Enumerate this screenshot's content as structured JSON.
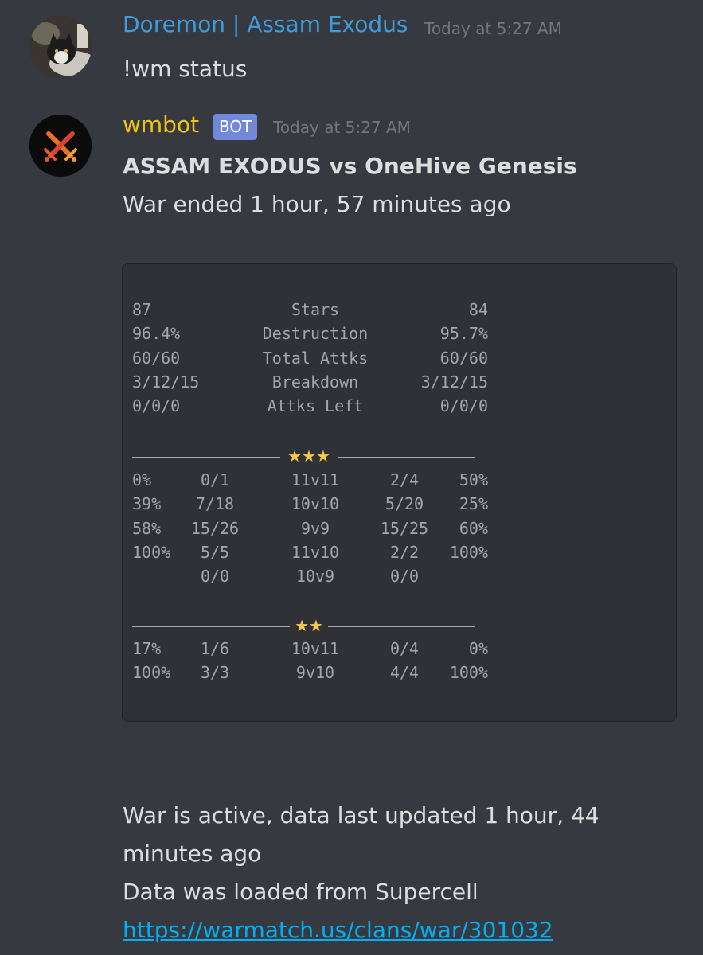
{
  "message1": {
    "username": "Doremon | Assam Exodus",
    "timestamp": "Today at 5:27 AM",
    "text": "!wm status"
  },
  "message2": {
    "username": "wmbot",
    "tag": "BOT",
    "timestamp": "Today at 5:27 AM",
    "title": "ASSAM EXODUS vs OneHive Genesis",
    "subtitle": "War ended 1 hour, 57 minutes ago",
    "summary": [
      {
        "left": "87",
        "label": "Stars",
        "right": "84"
      },
      {
        "left": "96.4%",
        "label": "Destruction",
        "right": "95.7%"
      },
      {
        "left": "60/60",
        "label": "Total Attks",
        "right": "60/60"
      },
      {
        "left": "3/12/15",
        "label": "Breakdown",
        "right": "3/12/15"
      },
      {
        "left": "0/0/0",
        "label": "Attks Left",
        "right": "0/0/0"
      }
    ],
    "three_star_header": "★★★",
    "three_star_rows": [
      {
        "lpct": "0%",
        "lfrac": "0/1",
        "match": "11v11",
        "rfrac": "2/4",
        "rpct": "50%"
      },
      {
        "lpct": "39%",
        "lfrac": "7/18",
        "match": "10v10",
        "rfrac": "5/20",
        "rpct": "25%"
      },
      {
        "lpct": "58%",
        "lfrac": "15/26",
        "match": "9v9",
        "rfrac": "15/25",
        "rpct": "60%"
      },
      {
        "lpct": "100%",
        "lfrac": "5/5",
        "match": "11v10",
        "rfrac": "2/2",
        "rpct": "100%"
      },
      {
        "lpct": "",
        "lfrac": "0/0",
        "match": "10v9",
        "rfrac": "0/0",
        "rpct": ""
      }
    ],
    "two_star_header": "★★",
    "two_star_rows": [
      {
        "lpct": "17%",
        "lfrac": "1/6",
        "match": "10v11",
        "rfrac": "0/4",
        "rpct": "0%"
      },
      {
        "lpct": "100%",
        "lfrac": "3/3",
        "match": "9v10",
        "rfrac": "4/4",
        "rpct": "100%"
      }
    ],
    "status_line1": "War is active, data last updated 1 hour, 44",
    "status_line2": "minutes ago",
    "source_line": "Data was loaded from Supercell",
    "link": "https://warmatch.us/clans/war/301032"
  }
}
